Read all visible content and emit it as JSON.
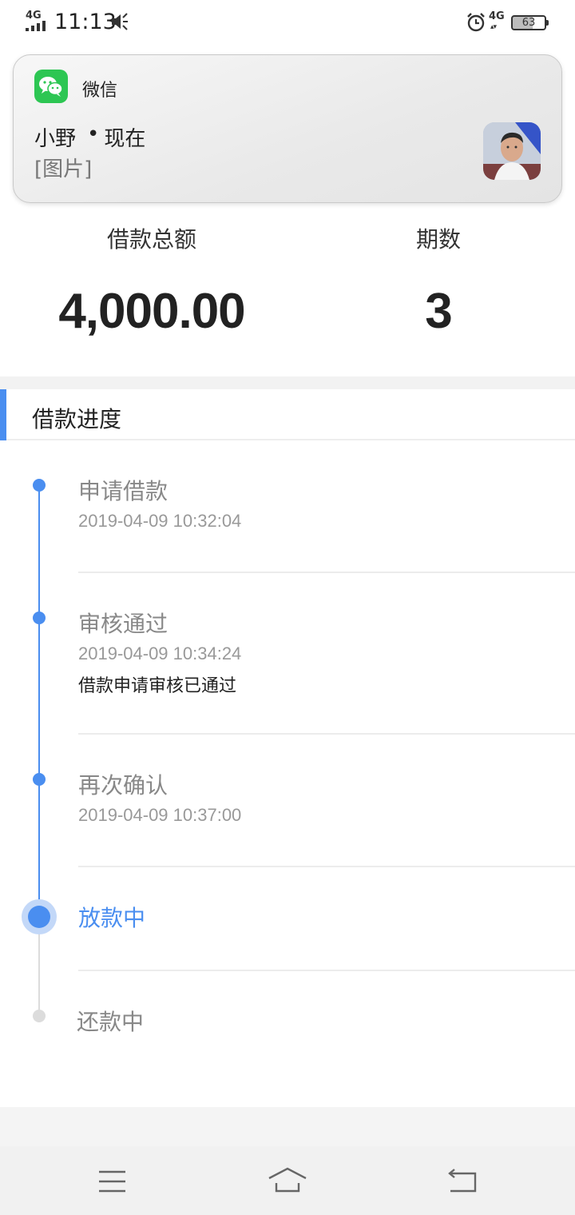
{
  "status_bar": {
    "network": "4G",
    "time": "11:13",
    "network_right": "4G",
    "battery": "63"
  },
  "notification": {
    "app_name": "微信",
    "sender": "小野",
    "separator": "•",
    "when": "现在",
    "message": "[图片]",
    "icon": "wechat-icon",
    "avatar": "avatar-thumbnail"
  },
  "summary": {
    "total_label": "借款总额",
    "total_value": "4,000.00",
    "periods_label": "期数",
    "periods_value": "3"
  },
  "progress": {
    "header": "借款进度",
    "steps": [
      {
        "title": "申请借款",
        "time": "2019-04-09 10:32:04",
        "status": "done"
      },
      {
        "title": "审核通过",
        "time": "2019-04-09 10:34:24",
        "note": "借款申请审核已通过",
        "status": "done"
      },
      {
        "title": "再次确认",
        "time": "2019-04-09 10:37:00",
        "status": "done"
      },
      {
        "title": "放款中",
        "status": "current"
      },
      {
        "title": "还款中",
        "status": "pending"
      }
    ]
  },
  "navigation": {
    "menu_icon": "menu-icon",
    "home_icon": "home-icon",
    "back_icon": "back-icon"
  },
  "colors": {
    "accent": "#4a8ef0",
    "pending": "#dcdcdc",
    "wechat_green": "#2dc653"
  }
}
